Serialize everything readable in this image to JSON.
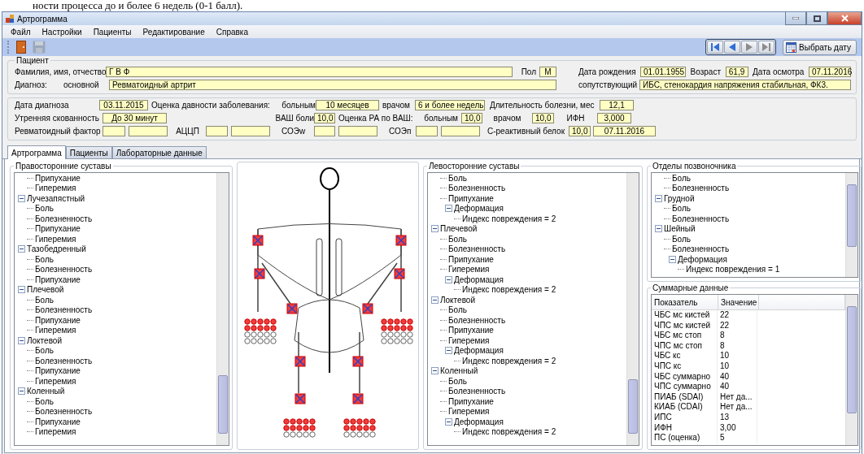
{
  "background_document": {
    "text": "ности процесса до и более 6 недель (0-1 балл)."
  },
  "window": {
    "title": "Артрограмма"
  },
  "menu": [
    "Файл",
    "Настройки",
    "Пациенты",
    "Редактирование",
    "Справка"
  ],
  "toolbar": {
    "tools": [
      {
        "kind": "exit",
        "disabled": false
      },
      {
        "kind": "save",
        "disabled": true
      }
    ],
    "nav_buttons": [
      {
        "kind": "first",
        "disabled": false
      },
      {
        "kind": "prev",
        "disabled": false
      },
      {
        "kind": "next",
        "disabled": true
      },
      {
        "kind": "last",
        "disabled": true
      }
    ],
    "date_button": "Выбрать дату"
  },
  "patient": {
    "legend": "Пациент",
    "name_label": "Фамилия, имя, отчество",
    "name": "Г В Ф",
    "sex_label": "Пол",
    "sex": "М",
    "birth_label": "Дата рождения",
    "birth": "01.01.1955",
    "age_label": "Возраст",
    "age": "61,9",
    "exam_label": "Дата осмотра",
    "exam": "07.11.2016",
    "diagnosis_label": "Диагноз:",
    "main_label": "основной",
    "main_diagnosis": "Ревматоидный артрит",
    "concomitant_label": "сопутствующий",
    "concomitant": "ИБС, стенокардия напряжения стабильная, ФК3."
  },
  "disease": {
    "diag_date_label": "Дата диагноза",
    "diag_date": "03.11.2015",
    "duration_label": "Оценка давности заболевания:",
    "by_patient_label": "больным",
    "by_patient": "10 месяцев",
    "by_doctor_label": "врачом",
    "by_doctor": "6 и более недель",
    "length_label": "Длительность болезни, мес",
    "length": "12,1",
    "stiffness_label": "Утренняя скованность",
    "stiffness": "До 30 минут",
    "vas_pain_label": "ВАШ боли",
    "vas_pain": "10,0",
    "ra_vas_label": "Оценка РА по ВАШ:",
    "ra_patient_label": "больным",
    "ra_patient": "10,0",
    "ra_doctor_label": "врачом",
    "ra_doctor": "10,0",
    "ifn_label": "ИФН",
    "ifn": "3,000",
    "rf_label": "Ревматоидный фактор",
    "accp_label": "АЦЦП",
    "esr_w_label": "СОЭw",
    "esr_p_label": "СОЭп",
    "crp_label": "С-реактивный белок",
    "crp": "10,0",
    "crp_date": "07.11.2016"
  },
  "tabs": [
    {
      "label": "Артрограмма",
      "selected": true
    },
    {
      "label": "Пациенты",
      "selected": false
    },
    {
      "label": "Лабораторные данные",
      "selected": false
    }
  ],
  "right_joints": {
    "legend": "Правосторонние суставы",
    "items": [
      {
        "children": [
          {
            "label": "Припухание"
          },
          {
            "label": "Гиперемия"
          }
        ]
      },
      {
        "label": "Лучезапястный",
        "expanded": true,
        "children": [
          {
            "label": "Боль"
          },
          {
            "label": "Болезненность"
          },
          {
            "label": "Припухание"
          },
          {
            "label": "Гиперемия"
          }
        ]
      },
      {
        "label": "Тазобедренный",
        "expanded": true,
        "children": [
          {
            "label": "Боль"
          },
          {
            "label": "Болезненность"
          },
          {
            "label": "Припухание"
          }
        ]
      },
      {
        "label": "Плечевой",
        "expanded": true,
        "children": [
          {
            "label": "Боль"
          },
          {
            "label": "Болезненность"
          },
          {
            "label": "Припухание"
          },
          {
            "label": "Гиперемия"
          }
        ]
      },
      {
        "label": "Локтевой",
        "expanded": true,
        "children": [
          {
            "label": "Боль"
          },
          {
            "label": "Болезненность"
          },
          {
            "label": "Припухание"
          },
          {
            "label": "Гиперемия"
          }
        ]
      },
      {
        "label": "Коленный",
        "expanded": true,
        "children": [
          {
            "label": "Боль"
          },
          {
            "label": "Болезненность"
          },
          {
            "label": "Припухание"
          },
          {
            "label": "Гиперемия"
          }
        ]
      }
    ]
  },
  "left_joints": {
    "legend": "Левосторонние суставы",
    "items": [
      {
        "children": [
          {
            "label": "Боль"
          },
          {
            "label": "Болезненность"
          },
          {
            "label": "Припухание"
          },
          {
            "label": "Деформация",
            "expanded": true,
            "children": [
              {
                "label": "Индекс повреждения = 2"
              }
            ]
          }
        ]
      },
      {
        "label": "Плечевой",
        "expanded": true,
        "children": [
          {
            "label": "Боль"
          },
          {
            "label": "Болезненность"
          },
          {
            "label": "Припухание"
          },
          {
            "label": "Гиперемия"
          },
          {
            "label": "Деформация",
            "expanded": true,
            "children": [
              {
                "label": "Индекс повреждения = 2"
              }
            ]
          }
        ]
      },
      {
        "label": "Локтевой",
        "expanded": true,
        "children": [
          {
            "label": "Боль"
          },
          {
            "label": "Болезненность"
          },
          {
            "label": "Припухание"
          },
          {
            "label": "Гиперемия"
          },
          {
            "label": "Деформация",
            "expanded": true,
            "children": [
              {
                "label": "Индекс повреждения = 2"
              }
            ]
          }
        ]
      },
      {
        "label": "Коленный",
        "expanded": true,
        "children": [
          {
            "label": "Боль"
          },
          {
            "label": "Болезненность"
          },
          {
            "label": "Припухание"
          },
          {
            "label": "Гиперемия"
          },
          {
            "label": "Деформация",
            "expanded": true,
            "children": [
              {
                "label": "Индекс повреждения = 2"
              }
            ]
          }
        ]
      }
    ]
  },
  "spine": {
    "legend": "Отделы позвоночника",
    "items": [
      {
        "children": [
          {
            "label": "Боль"
          },
          {
            "label": "Болезненность"
          }
        ]
      },
      {
        "label": "Грудной",
        "expanded": true,
        "children": [
          {
            "label": "Боль"
          },
          {
            "label": "Болезненность"
          }
        ]
      },
      {
        "label": "Шейный",
        "expanded": true,
        "children": [
          {
            "label": "Боль"
          },
          {
            "label": "Болезненность"
          },
          {
            "label": "Деформация",
            "expanded": true,
            "children": [
              {
                "label": "Индекс повреждения = 1"
              }
            ]
          }
        ]
      }
    ]
  },
  "summary": {
    "legend": "Суммарные данные",
    "columns": [
      "Показатель",
      "Значение"
    ],
    "rows": [
      [
        "ЧБС мс кистей",
        "22"
      ],
      [
        "ЧПС мс кистей",
        "22"
      ],
      [
        "ЧБС мс стоп",
        "8"
      ],
      [
        "ЧПС мс стоп",
        "8"
      ],
      [
        "ЧБС кс",
        "10"
      ],
      [
        "ЧПС кс",
        "10"
      ],
      [
        "ЧБС суммарно",
        "40"
      ],
      [
        "ЧПС суммарно",
        "40"
      ],
      [
        "ПИАБ (SDAI)",
        "Нет да..."
      ],
      [
        "КИАБ (CDAI)",
        "Нет да..."
      ],
      [
        "ИПС",
        "13"
      ],
      [
        "ИФН",
        "3,00"
      ],
      [
        "ПС (оценка)",
        "5"
      ]
    ]
  }
}
